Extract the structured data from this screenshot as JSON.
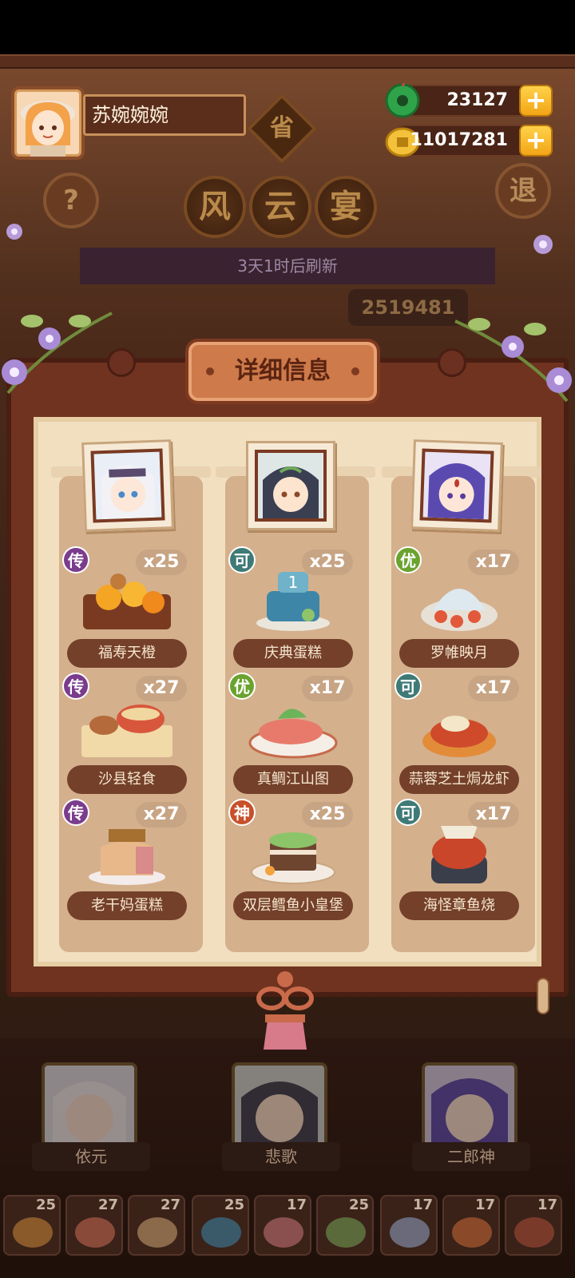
{
  "player": {
    "name": "苏婉婉婉"
  },
  "resources": {
    "jade": {
      "value": "23127",
      "icon": "jade-coin-icon"
    },
    "gold": {
      "value": "11017281",
      "icon": "gold-coin-icon"
    },
    "add_symbol": "+"
  },
  "buttons": {
    "help": "?",
    "exit": "退"
  },
  "event": {
    "tier": "省",
    "title_chars": [
      "风",
      "云",
      "宴"
    ],
    "refresh_text": "3天1时后刷新",
    "score": "2519481"
  },
  "panel": {
    "title": "详细信息",
    "columns": [
      {
        "character": "依元",
        "dishes": [
          {
            "badge": "传",
            "count": "x25",
            "name": "福寿天橙"
          },
          {
            "badge": "传",
            "count": "x27",
            "name": "沙县轻食"
          },
          {
            "badge": "传",
            "count": "x27",
            "name": "老干妈蛋糕"
          }
        ]
      },
      {
        "character": "悲歌",
        "dishes": [
          {
            "badge": "可",
            "count": "x25",
            "name": "庆典蛋糕"
          },
          {
            "badge": "优",
            "count": "x17",
            "name": "真鲷江山图"
          },
          {
            "badge": "神",
            "count": "x25",
            "name": "双层鳕鱼小皇堡"
          }
        ]
      },
      {
        "character": "二郎神",
        "dishes": [
          {
            "badge": "优",
            "count": "x17",
            "name": "罗帷映月"
          },
          {
            "badge": "可",
            "count": "x17",
            "name": "蒜蓉芝土焗龙虾"
          },
          {
            "badge": "可",
            "count": "x17",
            "name": "海怪章鱼烧"
          }
        ]
      }
    ]
  },
  "bottom": {
    "characters": [
      "依元",
      "悲歌",
      "二郎神"
    ],
    "dish_counts": [
      "25",
      "27",
      "27",
      "25",
      "17",
      "25",
      "17",
      "17",
      "17"
    ]
  },
  "colors": {
    "badge_legend": "#7a3c8c",
    "badge_excellent": "#6aa32e",
    "badge_good": "#3f7a76",
    "badge_divine": "#c8502a"
  }
}
